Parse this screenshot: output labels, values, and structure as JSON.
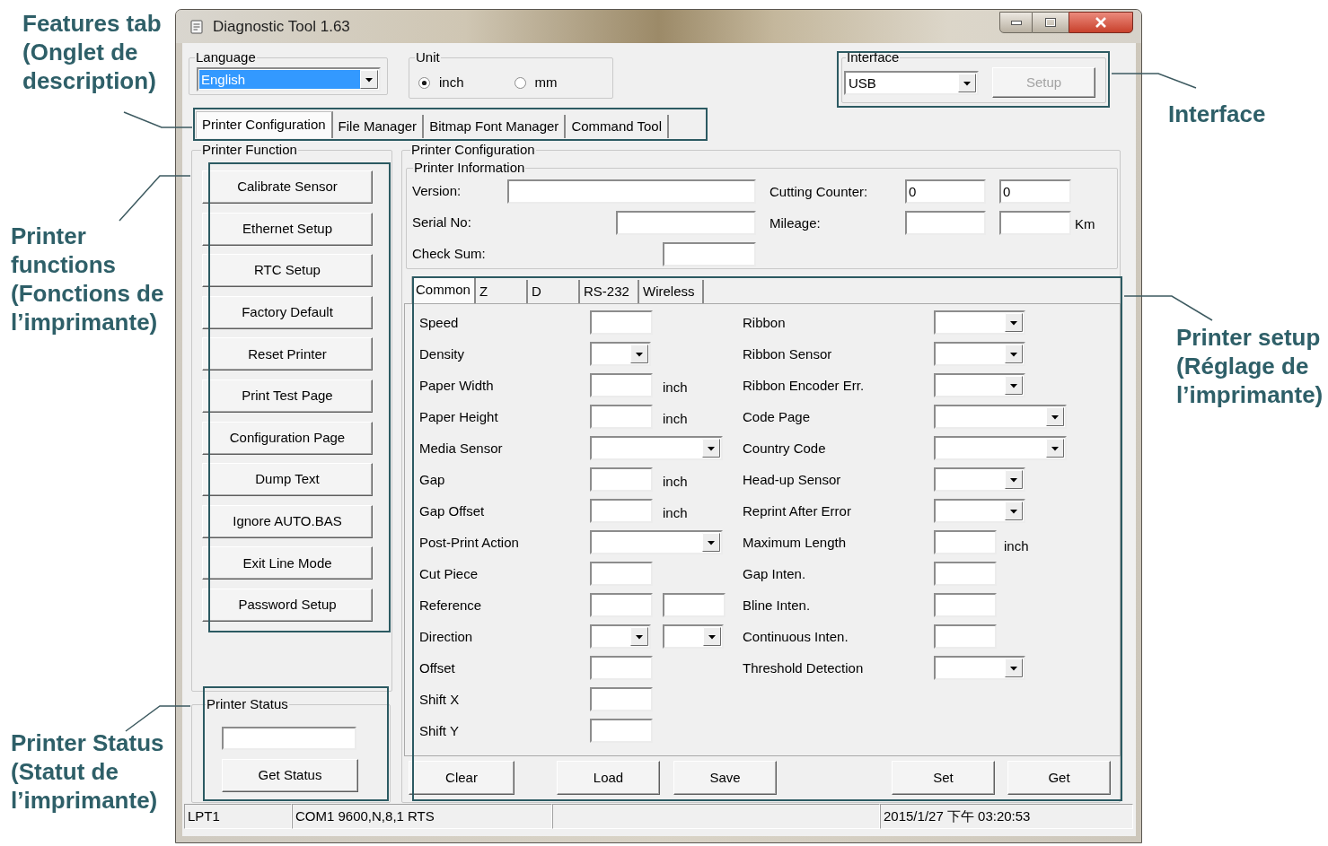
{
  "window": {
    "title": "Diagnostic Tool 1.63"
  },
  "language": {
    "label": "Language",
    "value": "English",
    "highlighted": true
  },
  "unit": {
    "label": "Unit",
    "options": [
      {
        "label": "inch",
        "selected": true
      },
      {
        "label": "mm",
        "selected": false
      }
    ]
  },
  "interface": {
    "label": "Interface",
    "value": "USB",
    "setup_button": {
      "label": "Setup",
      "disabled": true
    }
  },
  "tabs": [
    {
      "label": "Printer Configuration",
      "selected": true
    },
    {
      "label": "File Manager",
      "selected": false
    },
    {
      "label": "Bitmap Font Manager",
      "selected": false
    },
    {
      "label": "Command Tool",
      "selected": false
    }
  ],
  "printer_function": {
    "title": "Printer Function",
    "buttons": [
      "Calibrate Sensor",
      "Ethernet Setup",
      "RTC Setup",
      "Factory Default",
      "Reset Printer",
      "Print Test Page",
      "Configuration Page",
      "Dump Text",
      "Ignore AUTO.BAS",
      "Exit Line Mode",
      "Password Setup"
    ]
  },
  "printer_status": {
    "title": "Printer Status",
    "button": "Get Status"
  },
  "printer_configuration": {
    "title": "Printer Configuration",
    "printer_information": {
      "title": "Printer Information",
      "fields": [
        {
          "label": "Version:"
        },
        {
          "label": "Serial No:"
        },
        {
          "label": "Check Sum:"
        }
      ],
      "counters": [
        {
          "label": "Cutting Counter:",
          "values": [
            "0",
            "0"
          ]
        },
        {
          "label": "Mileage:",
          "unit": "Km"
        }
      ]
    },
    "setup_tabs": [
      {
        "label": "Common",
        "selected": true
      },
      {
        "label": "Z",
        "selected": false
      },
      {
        "label": "D",
        "selected": false
      },
      {
        "label": "RS-232",
        "selected": false
      },
      {
        "label": "Wireless",
        "selected": false
      }
    ],
    "settings_left": [
      {
        "label": "Speed",
        "kind": "input"
      },
      {
        "label": "Density",
        "kind": "select"
      },
      {
        "label": "Paper Width",
        "kind": "input",
        "unit": "inch"
      },
      {
        "label": "Paper Height",
        "kind": "input",
        "unit": "inch"
      },
      {
        "label": "Media Sensor",
        "kind": "wide_select"
      },
      {
        "label": "Gap",
        "kind": "input",
        "unit": "inch"
      },
      {
        "label": "Gap Offset",
        "kind": "input",
        "unit": "inch"
      },
      {
        "label": "Post-Print Action",
        "kind": "wide_select"
      },
      {
        "label": "Cut Piece",
        "kind": "input"
      },
      {
        "label": "Reference",
        "kind": "input_pair"
      },
      {
        "label": "Direction",
        "kind": "select_pair"
      },
      {
        "label": "Offset",
        "kind": "input"
      },
      {
        "label": "Shift X",
        "kind": "input"
      },
      {
        "label": "Shift Y",
        "kind": "input"
      }
    ],
    "settings_right": [
      {
        "label": "Ribbon",
        "kind": "select"
      },
      {
        "label": "Ribbon Sensor",
        "kind": "select"
      },
      {
        "label": "Ribbon Encoder Err.",
        "kind": "select"
      },
      {
        "label": "Code Page",
        "kind": "wide_select"
      },
      {
        "label": "Country Code",
        "kind": "wide_select"
      },
      {
        "label": "Head-up Sensor",
        "kind": "select"
      },
      {
        "label": "Reprint After Error",
        "kind": "select"
      },
      {
        "label": "Maximum Length",
        "kind": "input",
        "unit": "inch"
      },
      {
        "label": "Gap Inten.",
        "kind": "input"
      },
      {
        "label": "Bline Inten.",
        "kind": "input"
      },
      {
        "label": "Continuous Inten.",
        "kind": "input"
      },
      {
        "label": "Threshold Detection",
        "kind": "select"
      }
    ],
    "buttons": [
      "Clear",
      "Load",
      "Save",
      "Set",
      "Get"
    ]
  },
  "status_bar": {
    "port": "LPT1",
    "connection": "COM1 9600,N,8,1 RTS",
    "timestamp": "2015/1/27 下午 03:20:53"
  },
  "annotations": [
    {
      "text": "Features tab (Onglet de description)"
    },
    {
      "text": "Printer functions (Fonctions de l’imprimante)"
    },
    {
      "text": "Printer Status (Statut de l’imprimante)"
    },
    {
      "text": "Interface"
    },
    {
      "text": "Printer setup (Réglage de l’imprimante)"
    }
  ]
}
